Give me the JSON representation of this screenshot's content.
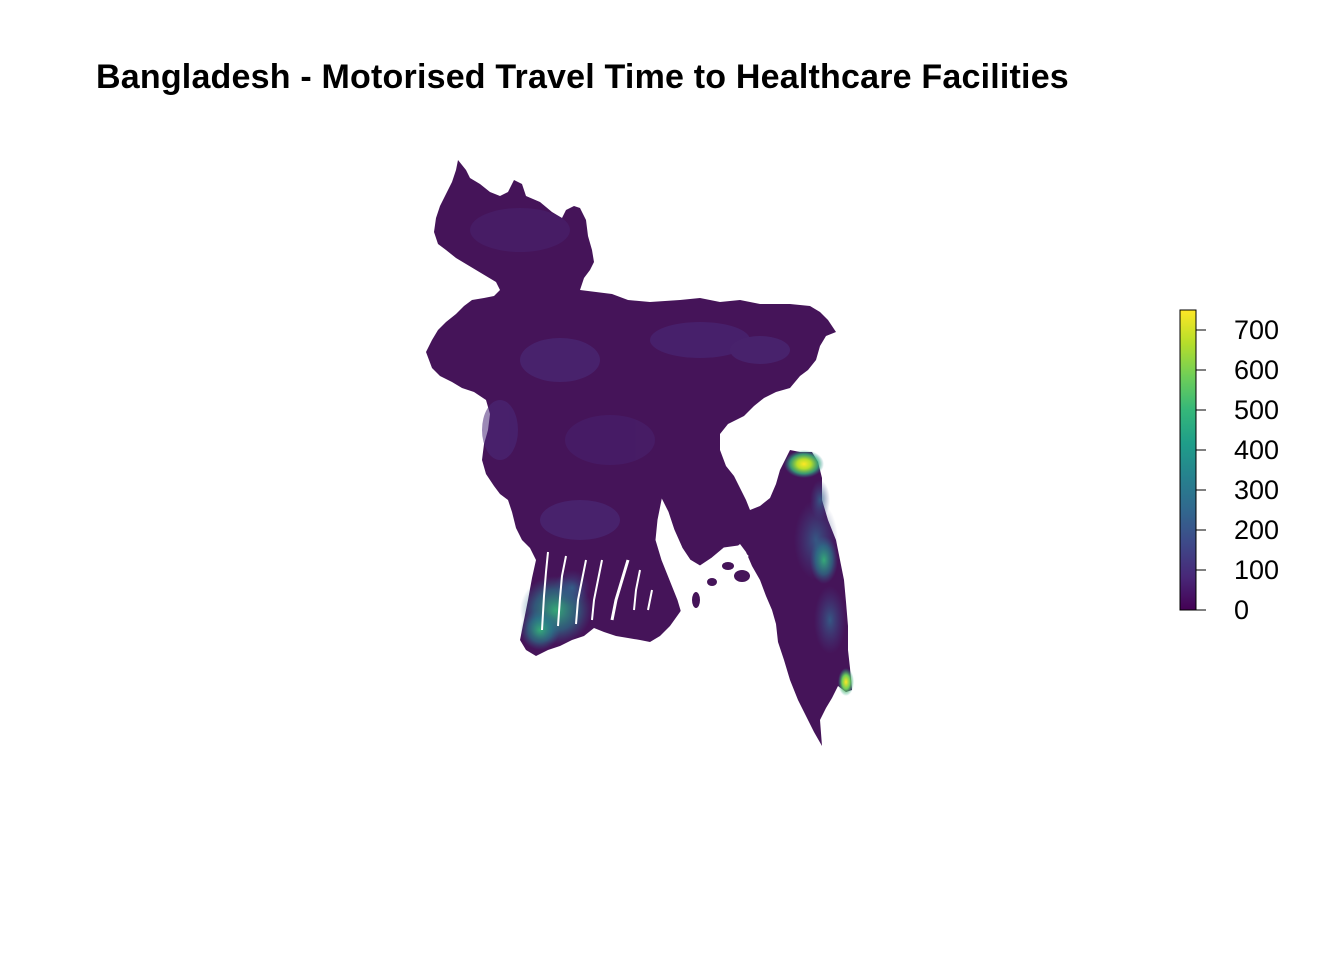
{
  "title": "Bangladesh - Motorised Travel Time to Healthcare Facilities",
  "legend": {
    "min": 0,
    "max": 750,
    "ticks": [
      "0",
      "100",
      "200",
      "300",
      "400",
      "500",
      "600",
      "700"
    ],
    "tick_values": [
      0,
      100,
      200,
      300,
      400,
      500,
      600,
      700
    ],
    "colormap": [
      "#440154",
      "#482878",
      "#3e4989",
      "#31688e",
      "#26828e",
      "#1f9e89",
      "#35b779",
      "#6ece58",
      "#b5de2b",
      "#fde725"
    ]
  },
  "colors": {
    "land_base": "#451459",
    "land_shade": "#4a2a7a",
    "water": "#ffffff"
  }
}
